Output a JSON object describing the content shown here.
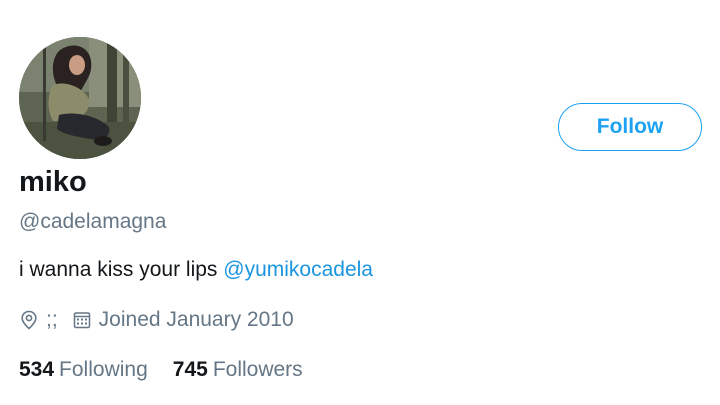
{
  "profile": {
    "display_name": "miko",
    "handle": "@cadelamagna",
    "bio_text": "i wanna kiss your lips ",
    "bio_mention": "@yumikocadela",
    "location": ";;",
    "joined": "Joined January 2010",
    "follow_label": "Follow"
  },
  "stats": {
    "following_count": "534",
    "following_label": "Following",
    "followers_count": "745",
    "followers_label": "Followers"
  },
  "icons": {
    "location": "location-pin-icon",
    "joined": "calendar-icon"
  },
  "colors": {
    "accent": "#1da1f2",
    "mention": "#1b95e0",
    "secondary_text": "#657786",
    "primary_text": "#14171a"
  }
}
